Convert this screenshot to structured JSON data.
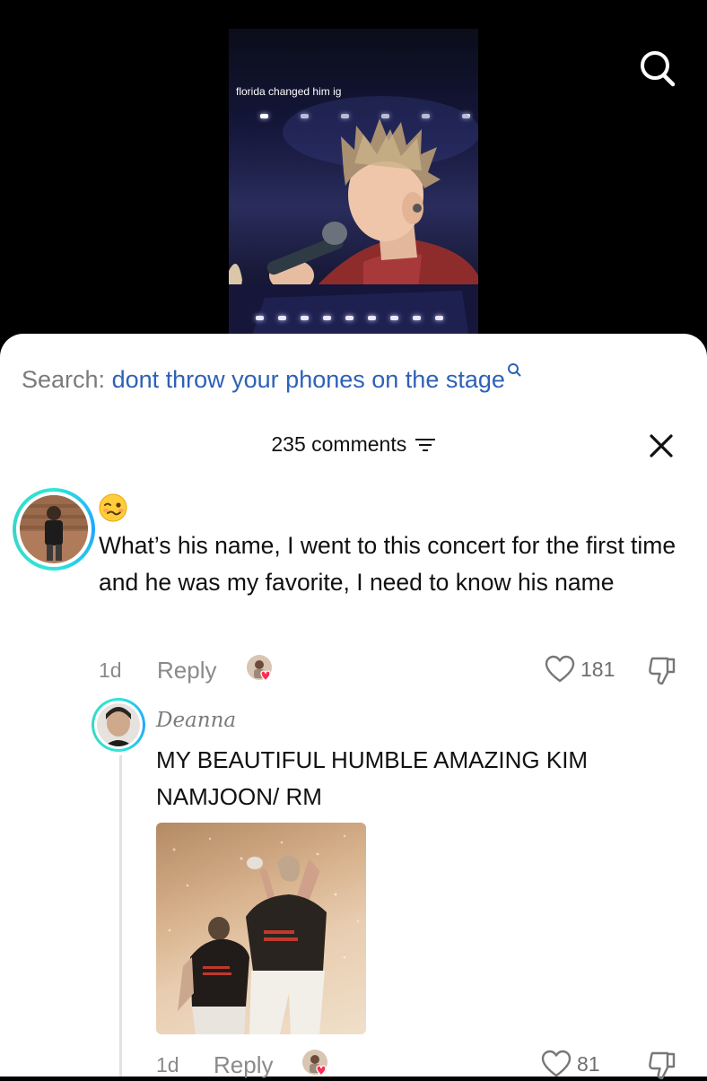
{
  "video": {
    "caption": "florida changed him ig"
  },
  "top_bar": {
    "search_icon": "search-icon"
  },
  "sheet": {
    "search_label": "Search:",
    "search_query": "dont throw your phones on the stage",
    "comment_count_label": "235 comments",
    "filter_icon": "filter-icon",
    "close_icon": "close-icon"
  },
  "comments": [
    {
      "emoji": "woozy-face-emoji",
      "text": "What’s his name, I went to this concert for the first time and he was my favorite, I need to know his name",
      "time": "1d",
      "reply_label": "Reply",
      "like_count": "181"
    }
  ],
  "replies": [
    {
      "username": "Deanna",
      "text": "MY BEAUTIFUL HUMBLE AMAZING KIM NAMJOON/ RM",
      "time": "1d",
      "reply_label": "Reply",
      "like_count": "81"
    }
  ],
  "colors": {
    "search_query": "#2e61b8",
    "muted_text": "#8a8a8a",
    "avatar_ring": "#2ee7d8",
    "liked_heart": "#fe2c55"
  }
}
